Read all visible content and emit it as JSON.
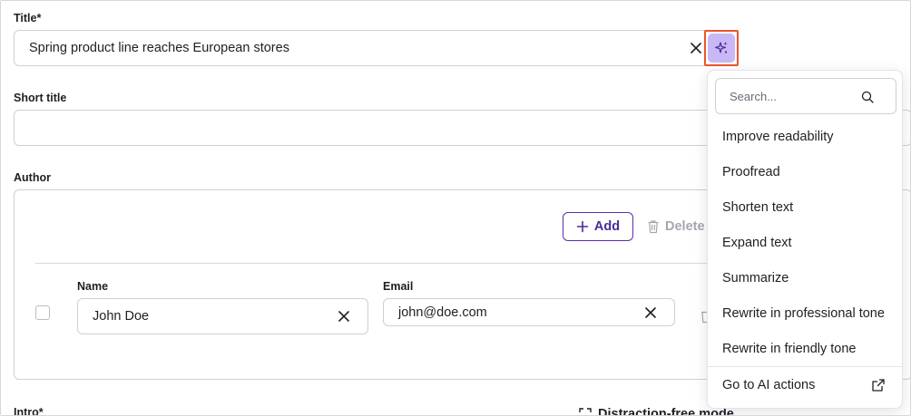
{
  "form": {
    "title_label": "Title*",
    "title_value": "Spring product line reaches European stores",
    "short_title_label": "Short title",
    "short_title_value": "",
    "author_label": "Author",
    "intro_label": "Intro*"
  },
  "author_panel": {
    "add_label": "Add",
    "delete_label": "Delete",
    "name_label": "Name",
    "name_value": "John Doe",
    "email_label": "Email",
    "email_value": "john@doe.com"
  },
  "bottom": {
    "partial_text": "Distraction-free mode"
  },
  "ai_menu": {
    "search_placeholder": "Search...",
    "items": [
      {
        "label": "Improve readability"
      },
      {
        "label": "Proofread"
      },
      {
        "label": "Shorten text"
      },
      {
        "label": "Expand text"
      },
      {
        "label": "Summarize"
      },
      {
        "label": "Rewrite in professional tone"
      },
      {
        "label": "Rewrite in friendly tone"
      }
    ],
    "footer_label": "Go to AI actions"
  },
  "colors": {
    "accent": "#5b2fb3",
    "ai_button_bg": "#c9b8f5",
    "highlight": "#e8572b"
  },
  "icons": {
    "ai": "sparkles-icon",
    "clear": "close-icon",
    "add": "plus-icon",
    "delete": "trash-icon",
    "search": "search-icon",
    "external": "external-link-icon",
    "expand": "expand-icon"
  }
}
